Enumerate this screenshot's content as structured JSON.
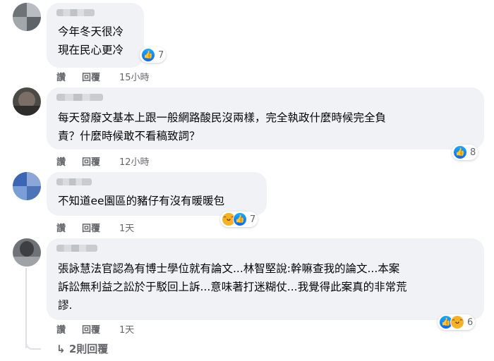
{
  "comments": [
    {
      "text": "今年冬天很冷\n現在民心更冷",
      "reaction_count": "7",
      "actions": {
        "like": "讚",
        "reply": "回覆",
        "time": "15小時"
      }
    },
    {
      "text": "每天發廢文基本上跟一般網路酸民沒兩樣，完全執政什麼時候完全負\n責？什麼時候敢不看稿致詞？",
      "reaction_count": "8",
      "actions": {
        "like": "讚",
        "reply": "回覆",
        "time": "12小時"
      }
    },
    {
      "text": "不知道ee園區的豬仔有沒有暖暖包",
      "reaction_count": "7",
      "actions": {
        "like": "讚",
        "reply": "回覆",
        "time": "1天"
      }
    },
    {
      "text": "張詠慧法官認為有博士學位就有論文...林智堅說:幹嘛查我的論文...本案\n訴訟無利益之訟於于駁回上訴...意味著打迷糊仗...我覺得此案真的非常荒\n謬.",
      "reaction_count": "6",
      "actions": {
        "like": "讚",
        "reply": "回覆",
        "time": "1天"
      }
    }
  ],
  "replies_link": "2則回覆",
  "icons": {
    "like": "like-icon",
    "haha": "haha-icon",
    "reply_arrow": "reply-arrow-icon"
  },
  "colors": {
    "like_blue": "#0866ff",
    "bubble_bg": "#f0f2f5",
    "meta_gray": "#65676b"
  }
}
